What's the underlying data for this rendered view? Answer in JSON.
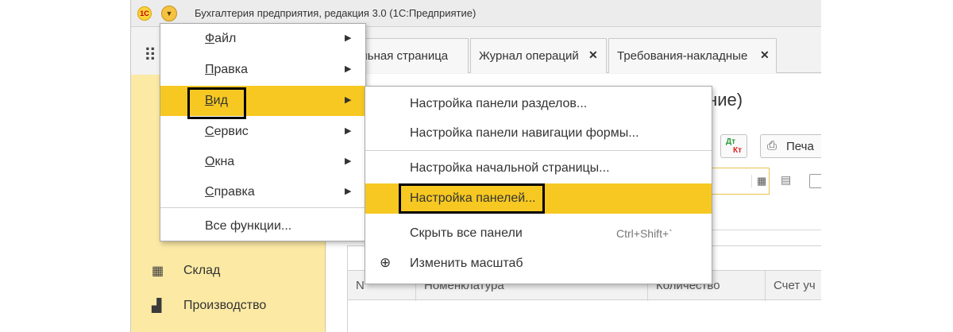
{
  "app": {
    "logo": "1С",
    "title": "Бухгалтерия предприятия, редакция 3.0  (1С:Предприятие)"
  },
  "tabs": [
    {
      "label": "Начальная страница",
      "closable": false
    },
    {
      "label": "Журнал операций",
      "closable": true
    },
    {
      "label": "Требования-накладные",
      "closable": true
    }
  ],
  "sidebar": {
    "items": [
      {
        "label": "Склад",
        "icon": "warehouse-icon"
      },
      {
        "label": "Производство",
        "icon": "factory-icon"
      }
    ]
  },
  "content": {
    "title_fragment": "дание)",
    "dtkt_top": "Дт",
    "dtkt_bottom": "Кт",
    "print_label": "Печа",
    "table_headers": [
      "N",
      "Номенклатура",
      "Количество",
      "Счет уч"
    ]
  },
  "main_menu": {
    "items": [
      {
        "label": "Файл",
        "accel": "Ф",
        "rest": "айл",
        "submenu": true
      },
      {
        "label": "Правка",
        "accel": "П",
        "rest": "равка",
        "submenu": true
      },
      {
        "label": "Вид",
        "accel": "В",
        "rest": "ид",
        "submenu": true,
        "active": true
      },
      {
        "label": "Сервис",
        "accel": "С",
        "rest": "ервис",
        "submenu": true
      },
      {
        "label": "Окна",
        "accel": "О",
        "rest": "кна",
        "submenu": true
      },
      {
        "label": "Справка",
        "accel": "С",
        "rest": "правка",
        "submenu": true
      },
      {
        "label": "Все функции...",
        "submenu": false
      }
    ]
  },
  "sub_menu": {
    "items": [
      {
        "label": "Настройка панели разделов..."
      },
      {
        "label": "Настройка панели навигации формы..."
      },
      {
        "label": "Настройка начальной страницы..."
      },
      {
        "label": "Настройка панелей...",
        "active": true
      },
      {
        "label": "Скрыть все панели",
        "shortcut": "Ctrl+Shift+`"
      },
      {
        "label": "Изменить масштаб",
        "icon": "zoom-icon"
      }
    ]
  },
  "colors": {
    "accent": "#f6c821",
    "sidebar": "#fbe9a4",
    "highlight_border": "#000000"
  }
}
